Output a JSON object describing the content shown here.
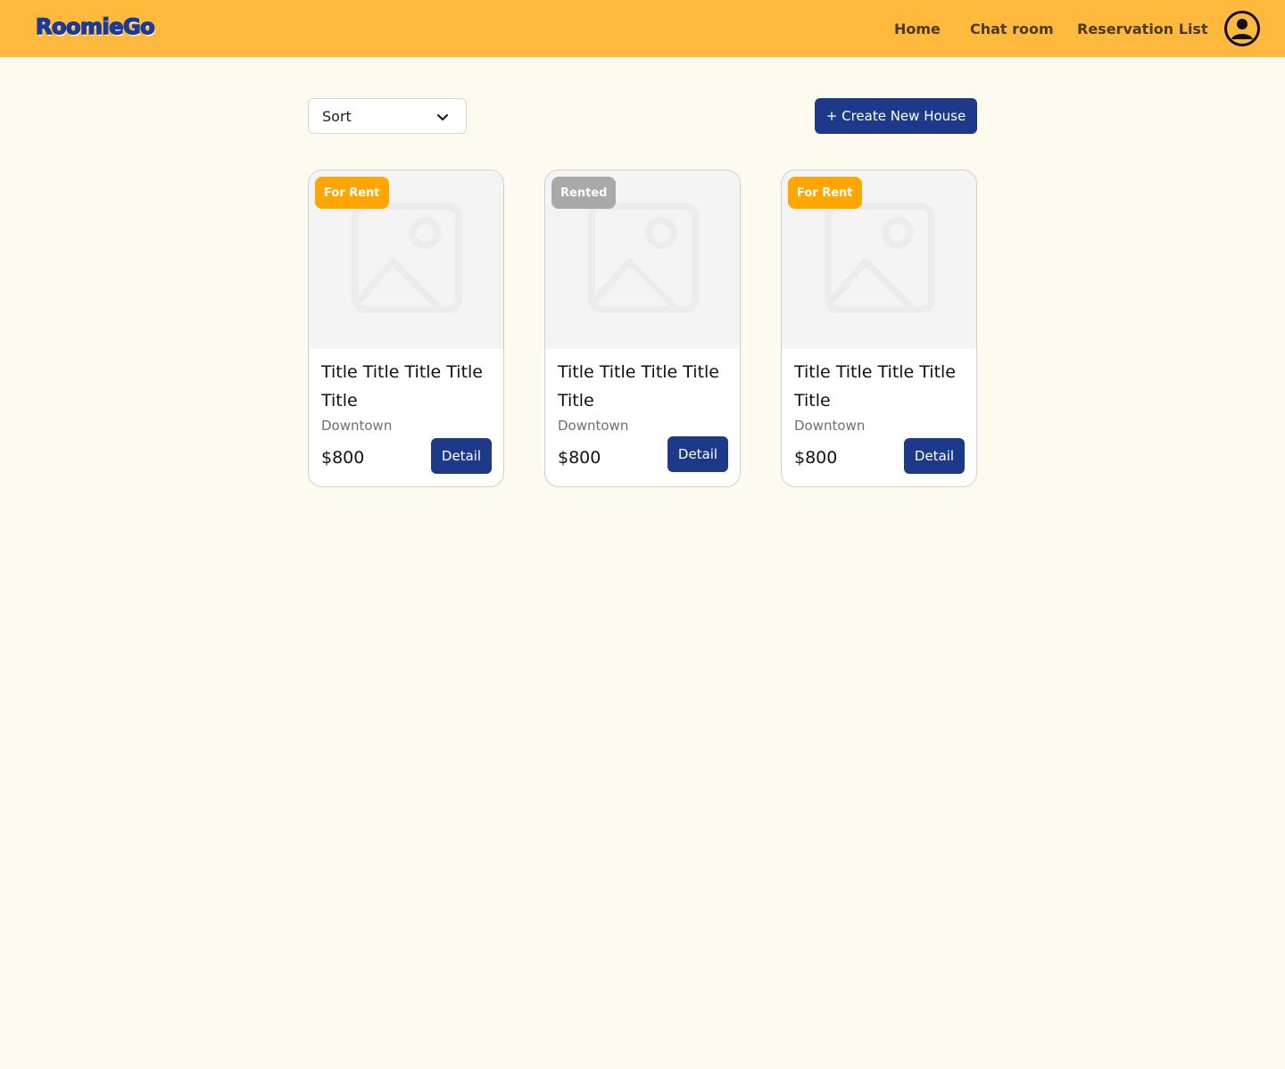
{
  "header": {
    "logo": "RoomieGo",
    "nav": [
      "Home",
      "Chat room",
      "Reservation List"
    ],
    "background_color": "#ffb93d",
    "logo_color": "#1f3b8f"
  },
  "toolbar": {
    "sort_label": "Sort",
    "create_label": "+ Create New House",
    "accent_color": "#1d3a8a"
  },
  "cards": [
    {
      "status": "For Rent",
      "title": "Title Title Title Title Title",
      "location": "Downtown",
      "price": "$800",
      "button": "Detail"
    },
    {
      "status": "Rented",
      "title": "Title Title Title Title Title",
      "location": "Downtown",
      "price": "$800",
      "button": "Detail"
    },
    {
      "status": "For Rent",
      "title": "Title Title Title Title Title",
      "location": "Downtown",
      "price": "$800",
      "button": "Detail"
    }
  ],
  "colors": {
    "page_background": "#fefaef",
    "for_rent_badge": "#ffa700",
    "rented_badge": "#a9a9a9"
  },
  "icons": {
    "profile": "user-circle-icon",
    "sort": "chevron-down-icon",
    "thumbnail": "image-placeholder-icon"
  }
}
